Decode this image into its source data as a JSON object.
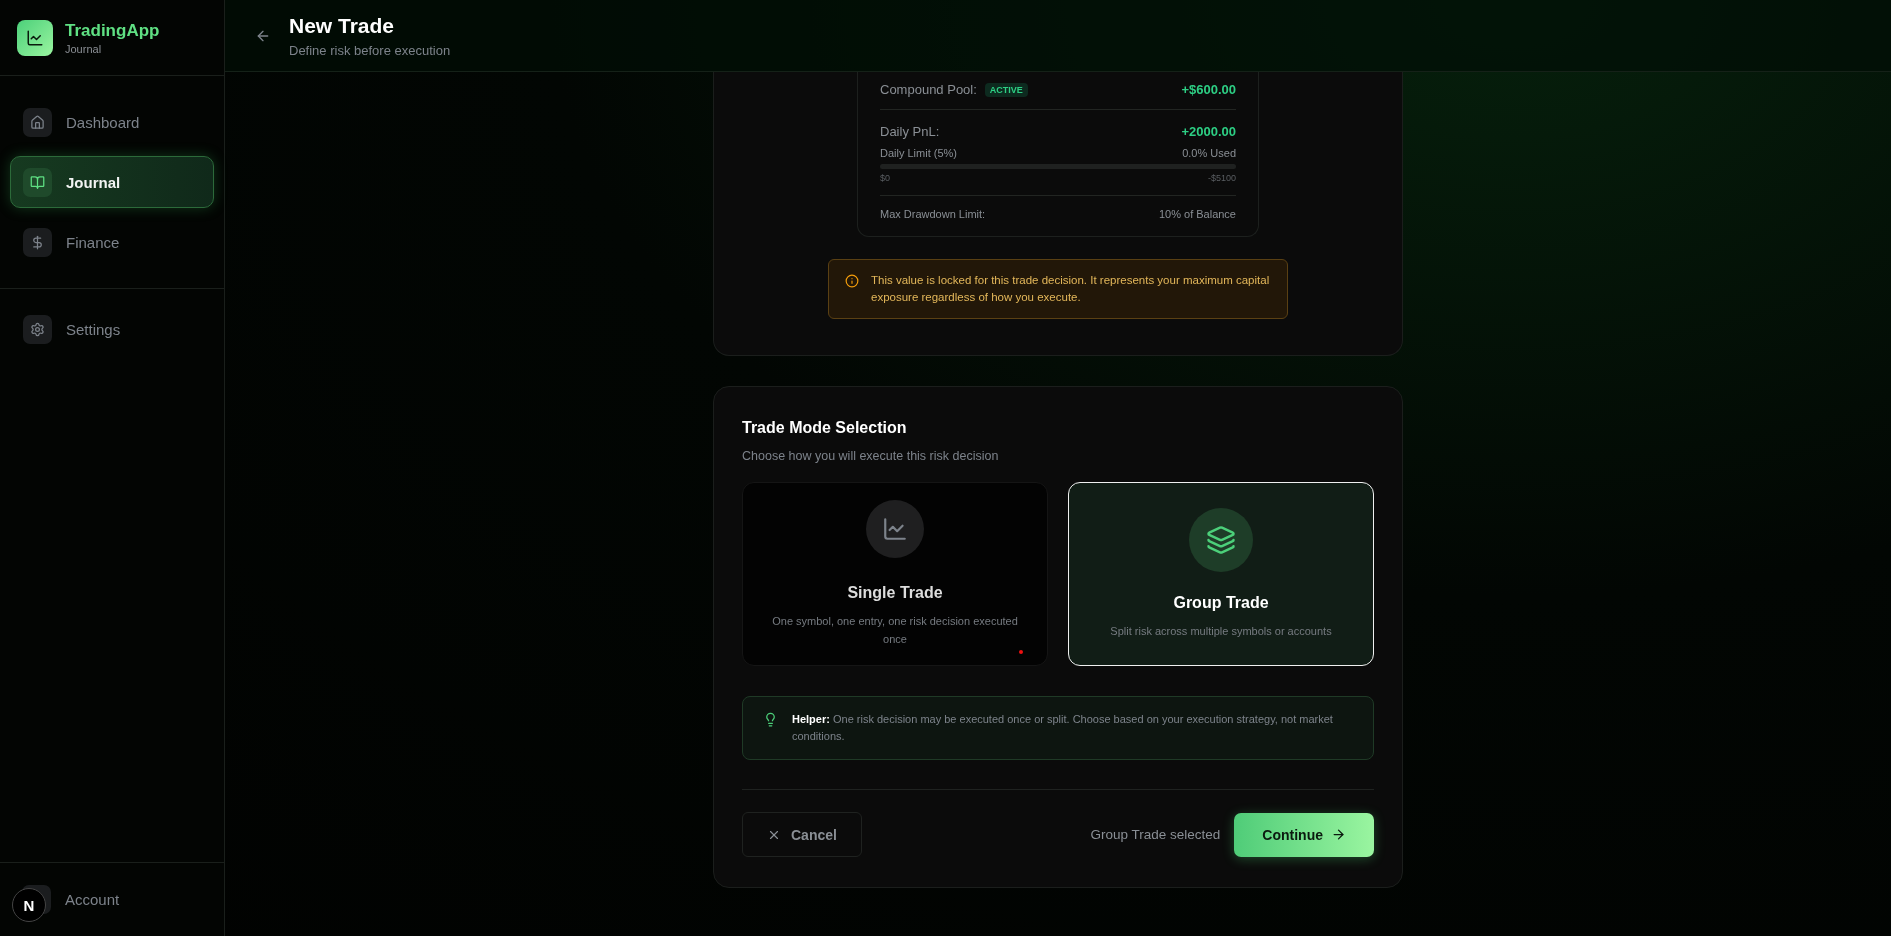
{
  "sidebar": {
    "app_name": "TradingApp",
    "app_subtitle": "Journal",
    "sections": [
      [
        {
          "label": "Dashboard",
          "selected": false
        },
        {
          "label": "Journal",
          "selected": true
        },
        {
          "label": "Finance",
          "selected": false
        }
      ],
      [
        {
          "label": "Settings",
          "selected": false
        }
      ]
    ],
    "account": "Account",
    "dev_badge": "N"
  },
  "header": {
    "title": "New Trade",
    "subtitle": "Define risk before execution"
  },
  "risk_summary": {
    "compound_pool": {
      "label": "Compound Pool:",
      "badge": "ACTIVE",
      "value": "+$600.00"
    },
    "daily_pnl": {
      "label": "Daily PnL:",
      "value": "+2000.00"
    },
    "daily_limit": {
      "label": "Daily Limit (5%)",
      "reading": "0.0% Used",
      "level": 0,
      "min_label": "$0",
      "max_label": "-$5100"
    },
    "max_drawdown": {
      "label": "Max Drawdown Limit:",
      "value": "10% of Balance"
    },
    "notice": "This value is locked for this trade decision. It represents your maximum capital exposure regardless of how you execute."
  },
  "trade_mode": {
    "title": "Trade Mode Selection",
    "subtitle": "Choose how you will execute this risk decision",
    "options": [
      {
        "kind": "single",
        "title": "Single Trade",
        "description": "One symbol, one entry, one risk decision executed once",
        "selected": false
      },
      {
        "kind": "group",
        "title": "Group Trade",
        "description": "Split risk across multiple symbols or accounts",
        "selected": true
      }
    ],
    "helper": "**Helper:** One risk decision may be executed once or split. Choose based on your execution strategy, not market conditions.",
    "cancel": "Cancel",
    "status": "Group Trade selected",
    "continue": "Continue"
  }
}
